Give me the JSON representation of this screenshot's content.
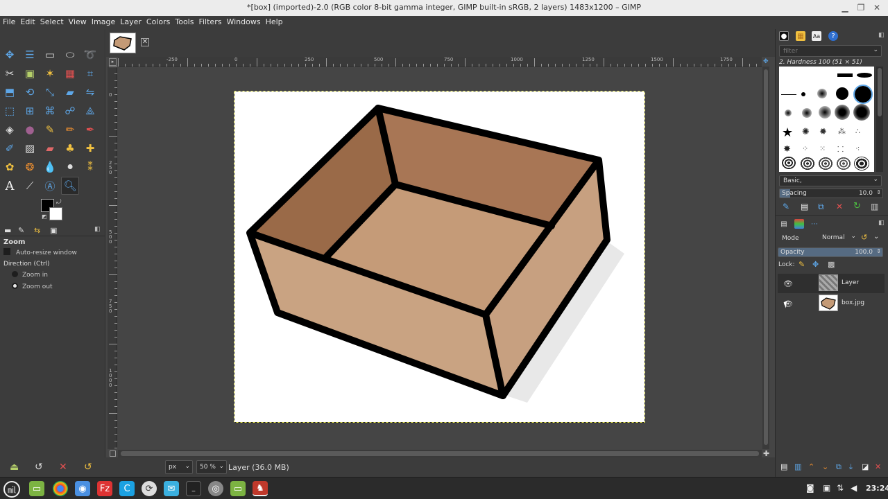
{
  "window": {
    "title": "*[box] (imported)-2.0 (RGB color 8-bit gamma integer, GIMP built-in sRGB, 2 layers) 1483x1200 – GIMP"
  },
  "menu": [
    "File",
    "Edit",
    "Select",
    "View",
    "Image",
    "Layer",
    "Colors",
    "Tools",
    "Filters",
    "Windows",
    "Help"
  ],
  "tool_options": {
    "title": "Zoom",
    "auto_resize": "Auto-resize window",
    "direction_label": "Direction  (Ctrl)",
    "zoom_in": "Zoom in",
    "zoom_out": "Zoom out",
    "selected_direction": "Zoom out"
  },
  "ruler": {
    "labels": [
      "-250",
      "0",
      "250",
      "500",
      "750",
      "1000",
      "1250",
      "1500",
      "1750"
    ],
    "vlabels": [
      "0",
      "2 5 0",
      "5 0 0",
      "7 5 0",
      "1 0 0 0"
    ]
  },
  "status": {
    "unit": "px",
    "zoom": "50 %",
    "info": "Layer (36.0 MB)"
  },
  "brushes": {
    "filter_placeholder": "filter",
    "selected": "2. Hardness 100 (51 × 51)",
    "preset": "Basic,",
    "spacing_label": "Spacing",
    "spacing_value": "10.0",
    "spacing_fraction": 0.1
  },
  "layers": {
    "mode_label": "Mode",
    "mode_value": "Normal",
    "opacity_label": "Opacity",
    "opacity_value": "100.0",
    "opacity_fraction": 1.0,
    "lock_label": "Lock:",
    "items": [
      {
        "name": "Layer",
        "visible": true
      },
      {
        "name": "box.jpg",
        "visible": true
      }
    ]
  },
  "taskbar": {
    "clock": "23:24"
  },
  "colors": {
    "fg": "#000000",
    "bg": "#ffffff",
    "selection_marquee": "#e8e84a"
  }
}
